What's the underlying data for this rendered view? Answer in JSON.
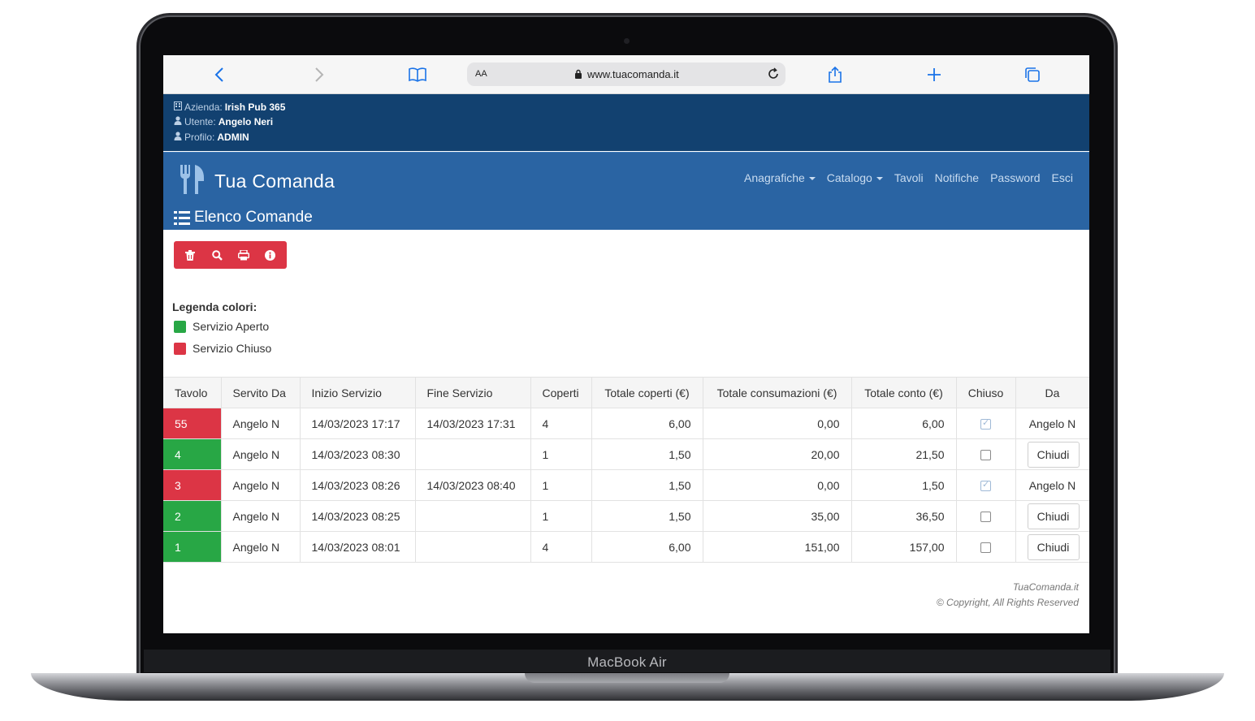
{
  "device": {
    "model_label": "MacBook Air"
  },
  "browser": {
    "reader_label": "AA",
    "url": "www.tuacomanda.it"
  },
  "session": {
    "azienda_label": "Azienda:",
    "azienda": "Irish Pub 365",
    "utente_label": "Utente:",
    "utente": "Angelo Neri",
    "profilo_label": "Profilo:",
    "profilo": "ADMIN"
  },
  "nav": {
    "brand": "Tua Comanda",
    "items": [
      "Anagrafiche",
      "Catalogo",
      "Tavoli",
      "Notifiche",
      "Password",
      "Esci"
    ]
  },
  "page": {
    "title": "Elenco Comande"
  },
  "toolbar": {
    "icons": [
      "trash-icon",
      "search-icon",
      "print-icon",
      "info-icon"
    ]
  },
  "legend": {
    "title": "Legenda colori:",
    "items": [
      {
        "label": "Servizio Aperto",
        "color": "#28a745"
      },
      {
        "label": "Servizio Chiuso",
        "color": "#dc3545"
      }
    ]
  },
  "table": {
    "columns": [
      "Tavolo",
      "Servito Da",
      "Inizio Servizio",
      "Fine Servizio",
      "Coperti",
      "Totale coperti (€)",
      "Totale consumazioni (€)",
      "Totale conto (€)",
      "Chiuso",
      "Da"
    ],
    "rows": [
      {
        "tavolo": "55",
        "status": "closed",
        "servito": "Angelo N",
        "inizio": "14/03/2023 17:17",
        "fine": "14/03/2023 17:31",
        "coperti": "4",
        "tot_coperti": "6,00",
        "tot_consumazioni": "0,00",
        "tot_conto": "6,00",
        "chiuso": true,
        "da": "Angelo N"
      },
      {
        "tavolo": "4",
        "status": "open",
        "servito": "Angelo N",
        "inizio": "14/03/2023 08:30",
        "fine": "",
        "coperti": "1",
        "tot_coperti": "1,50",
        "tot_consumazioni": "20,00",
        "tot_conto": "21,50",
        "chiuso": false,
        "da": "Chiudi"
      },
      {
        "tavolo": "3",
        "status": "closed",
        "servito": "Angelo N",
        "inizio": "14/03/2023 08:26",
        "fine": "14/03/2023 08:40",
        "coperti": "1",
        "tot_coperti": "1,50",
        "tot_consumazioni": "0,00",
        "tot_conto": "1,50",
        "chiuso": true,
        "da": "Angelo N"
      },
      {
        "tavolo": "2",
        "status": "open",
        "servito": "Angelo N",
        "inizio": "14/03/2023 08:25",
        "fine": "",
        "coperti": "1",
        "tot_coperti": "1,50",
        "tot_consumazioni": "35,00",
        "tot_conto": "36,50",
        "chiuso": false,
        "da": "Chiudi"
      },
      {
        "tavolo": "1",
        "status": "open",
        "servito": "Angelo N",
        "inizio": "14/03/2023 08:01",
        "fine": "",
        "coperti": "4",
        "tot_coperti": "6,00",
        "tot_consumazioni": "151,00",
        "tot_conto": "157,00",
        "chiuso": false,
        "da": "Chiudi"
      }
    ]
  },
  "footer": {
    "line1": "TuaComanda.it",
    "line2": "© Copyright, All Rights Reserved"
  },
  "colors": {
    "header_dark": "#124170",
    "navbar": "#2a64a3",
    "open": "#28a745",
    "closed": "#dc3545"
  }
}
